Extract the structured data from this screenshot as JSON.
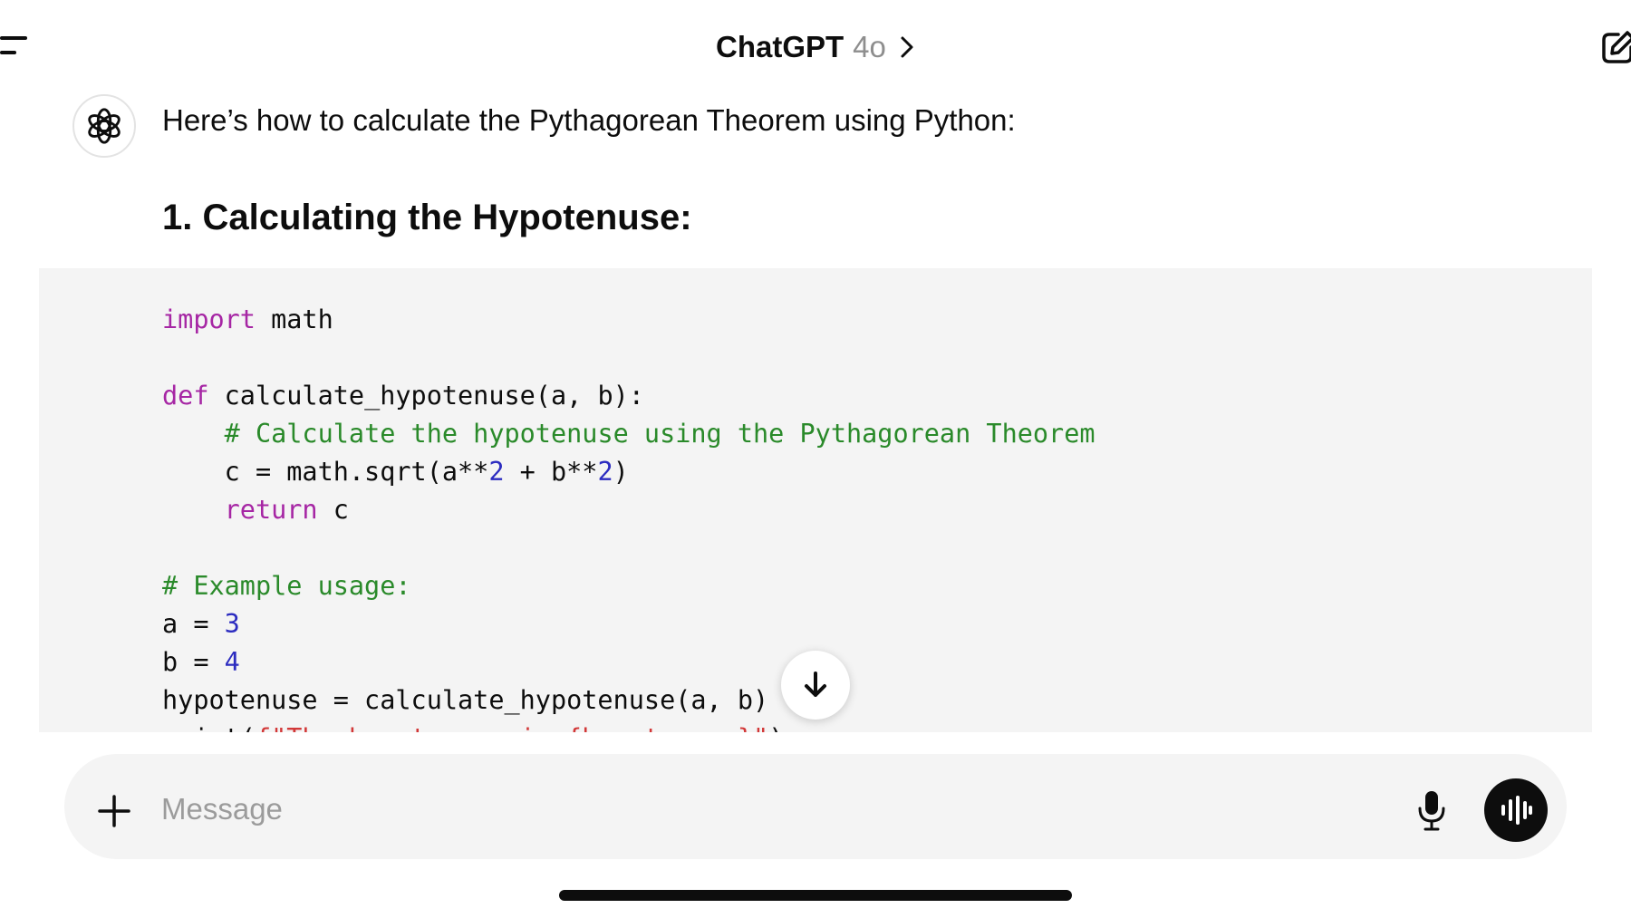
{
  "header": {
    "title": "ChatGPT",
    "model": "4o",
    "icons": {
      "menu": "menu-icon",
      "chevron": "chevron-right-icon",
      "new_chat": "new-chat-icon"
    }
  },
  "message": {
    "avatar_icon": "openai-logo-icon",
    "intro": "Here’s how to calculate the Pythagorean Theorem using Python:",
    "heading": "1. Calculating the Hypotenuse:"
  },
  "code": {
    "language": "python",
    "lines": [
      [
        {
          "t": "import",
          "c": "kw"
        },
        {
          "t": " math"
        }
      ],
      [],
      [
        {
          "t": "def",
          "c": "kw"
        },
        {
          "t": " calculate_hypotenuse(a, b):"
        }
      ],
      [
        {
          "t": "    "
        },
        {
          "t": "# Calculate the hypotenuse using the Pythagorean Theorem",
          "c": "cm"
        }
      ],
      [
        {
          "t": "    c = math.sqrt(a**"
        },
        {
          "t": "2",
          "c": "num"
        },
        {
          "t": " + b**"
        },
        {
          "t": "2",
          "c": "num"
        },
        {
          "t": ")"
        }
      ],
      [
        {
          "t": "    "
        },
        {
          "t": "return",
          "c": "kw"
        },
        {
          "t": " c"
        }
      ],
      [],
      [
        {
          "t": "# Example usage:",
          "c": "cm"
        }
      ],
      [
        {
          "t": "a = "
        },
        {
          "t": "3",
          "c": "num"
        }
      ],
      [
        {
          "t": "b = "
        },
        {
          "t": "4",
          "c": "num"
        }
      ],
      [
        {
          "t": "hypotenuse = calculate_hypotenuse(a, b)"
        }
      ],
      [
        {
          "t": "print("
        },
        {
          "t": "f\"The hypotenuse is {hypotenuse}\"",
          "c": "str"
        },
        {
          "t": ")"
        }
      ]
    ]
  },
  "scroll_button": {
    "icon": "arrow-down-icon"
  },
  "composer": {
    "placeholder": "Message",
    "value": "",
    "icons": {
      "attach": "plus-icon",
      "mic": "mic-icon",
      "voice": "voice-mode-icon"
    }
  },
  "colors": {
    "keyword": "#a626a4",
    "comment": "#2a8a2a",
    "number": "#2c2cc0",
    "string": "#d23838",
    "code_bg": "#f4f4f4",
    "composer_bg": "#f4f4f4",
    "placeholder": "#9b9b9b"
  }
}
